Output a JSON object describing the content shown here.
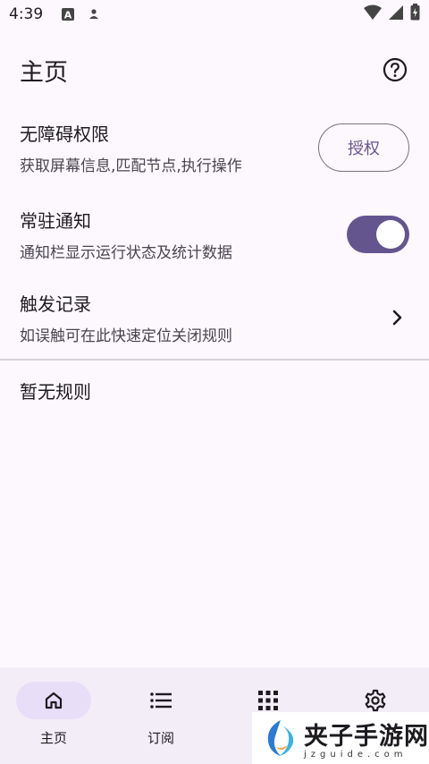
{
  "status_bar": {
    "time": "4:39"
  },
  "header": {
    "title": "主页",
    "help_icon": "help-circle-icon"
  },
  "settings": [
    {
      "title": "无障碍权限",
      "subtitle": "获取屏幕信息,匹配节点,执行操作",
      "action_label": "授权"
    },
    {
      "title": "常驻通知",
      "subtitle": "通知栏显示运行状态及统计数据",
      "switch_on": true
    },
    {
      "title": "触发记录",
      "subtitle": "如误触可在此快速定位关闭规则"
    }
  ],
  "empty_state": "暂无规则",
  "bottom_nav": {
    "items": [
      {
        "label": "主页",
        "icon": "home-icon",
        "active": true
      },
      {
        "label": "订阅",
        "icon": "list-icon",
        "active": false
      },
      {
        "label": "",
        "icon": "apps-grid-icon",
        "active": false
      },
      {
        "label": "",
        "icon": "gear-icon",
        "active": false
      }
    ]
  },
  "watermark": {
    "main": "夹子手游网",
    "sub": "jzguide.com"
  },
  "colors": {
    "accent": "#65558f",
    "background": "#fdf8fe",
    "nav_background": "#f3edf7",
    "nav_active_pill": "#e8def8"
  }
}
